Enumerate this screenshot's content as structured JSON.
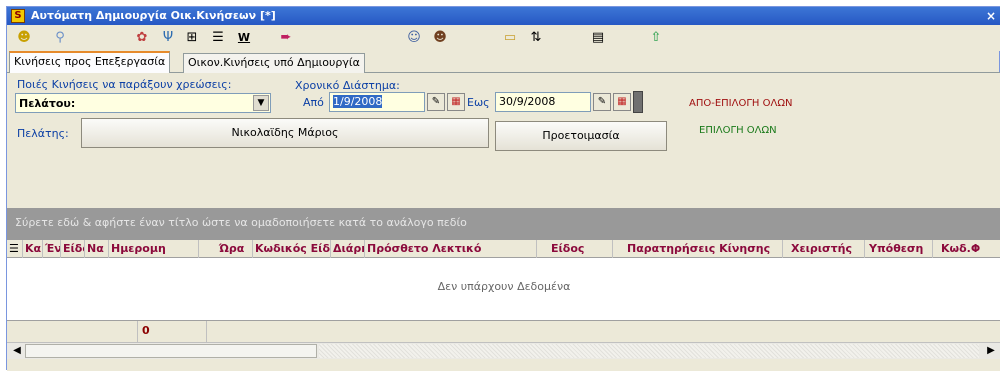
{
  "window": {
    "app_icon_letter": "S",
    "title": "Αυτόματη Δημιουργία Οικ.Κινήσεων [*]",
    "close_label": "×"
  },
  "toolbar": {
    "icons": [
      "exit-icon",
      "search-icon",
      "flower-icon",
      "fork-icon",
      "tree-icon",
      "list-icon",
      "w-icon",
      "arrow-right-icon",
      "person-icon",
      "person2-icon",
      "folder-icon",
      "sort-icon",
      "note-icon",
      "up-arrow-icon"
    ],
    "w_label": "W"
  },
  "tabs": [
    {
      "label": "Κινήσεις προς Επεξεργασία"
    },
    {
      "label": "Οικον.Κινήσεις υπό Δημιουργία"
    }
  ],
  "form": {
    "charges_label": "Ποιές Κινήσεις να παράξουν χρεώσεις:",
    "charges_value": "Πελάτου:",
    "period_label": "Χρονικό Διάστημα:",
    "from_label": "Από",
    "from_value": "1/9/2008",
    "to_label": "Εως",
    "to_value": "30/9/2008",
    "deselect_all": "ΑΠΟ-ΕΠΙΛΟΓΗ ΟΛΩΝ",
    "select_all": "ΕΠΙΛΟΓΗ ΟΛΩΝ",
    "customer_label": "Πελάτης:",
    "customer_value": "Νικολαϊδης Μάριος",
    "prepare_button": "Προετοιμασία"
  },
  "grid": {
    "group_hint": "Σύρετε εδώ & αφήστε έναν τίτλο ώστε να ομαδοποιήσετε κατά το ανάλογο πεδίο",
    "columns": [
      "Κα",
      "Έν",
      "Είδο",
      "Να",
      "Ημερομη",
      "Ώρα",
      "Κωδικός Είδο",
      "Διάρκ",
      "Πρόσθετο Λεκτικό",
      "Είδος",
      "Παρατηρήσεις Κίνησης",
      "Χειριστής",
      "Υπόθεση",
      "Κωδ.Φ"
    ],
    "no_data": "Δεν υπάρχουν Δεδομένα",
    "footer_count": "0"
  },
  "colors": {
    "titlebar": "#2658c4",
    "header_text": "#8b0a3c",
    "deselect_link": "#a01010",
    "select_link": "#1a7a1a"
  }
}
